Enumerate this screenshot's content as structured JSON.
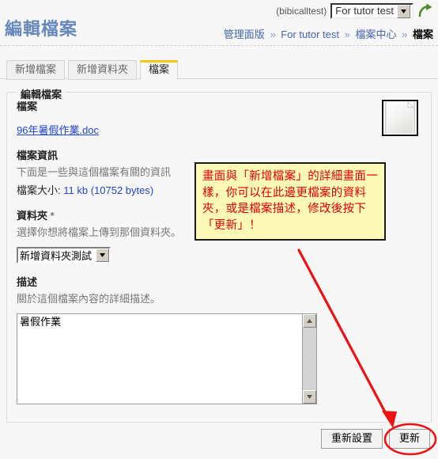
{
  "header": {
    "page_title": "編輯檔案",
    "username": "(bibicalltest)",
    "site_select_value": "For tutor test",
    "go_icon": "green-curved-arrow-icon",
    "breadcrumb": [
      {
        "label": "管理面版",
        "current": false
      },
      {
        "label": "For tutor test",
        "current": false
      },
      {
        "label": "檔案中心",
        "current": false
      },
      {
        "label": "檔案",
        "current": true
      }
    ],
    "breadcrumb_separator": "»"
  },
  "tabs": [
    {
      "label": "新增檔案",
      "active": false
    },
    {
      "label": "新增資料夾",
      "active": false
    },
    {
      "label": "檔案",
      "active": true
    }
  ],
  "form": {
    "legend": "編輯檔案",
    "file": {
      "label": "檔案",
      "link_text": "96年暑假作業.doc",
      "thumb_icon": "document-file-icon"
    },
    "file_info": {
      "label": "檔案資訊",
      "desc": "下面是一些與這個檔案有關的資訊",
      "size_label": "檔案大小:",
      "size_value": "11 kb (10752 bytes)"
    },
    "folder": {
      "label": "資料夾",
      "required_mark": "*",
      "desc": "選擇你想將檔案上傳到那個資料夾。",
      "select_value": "新增資料夾測試"
    },
    "description": {
      "label": "描述",
      "desc": "關於這個檔案內容的詳細描述。",
      "textarea_value": "暑假作業",
      "scroll_up_icon": "scroll-up-arrow-icon",
      "scroll_down_icon": "scroll-down-arrow-icon"
    }
  },
  "callout": {
    "text": "畫面與「新增檔案」的詳細畫面一樣，你可以在此邊更檔案的資料夾，或是檔案描述，修改後按下「更新」！",
    "background_color": "#fbf8b8",
    "text_color": "#dd0000",
    "border_color": "#1a1a1a"
  },
  "annotations": {
    "arrow_color": "#ee1111",
    "ellipse_color": "#ee1111",
    "arrow_name": "red-pointer-arrow",
    "ellipse_name": "red-highlight-ellipse"
  },
  "footer": {
    "reset_label": "重新設置",
    "submit_label": "更新"
  },
  "colors": {
    "page_background": "#f7f7f7",
    "title_color": "#6688bb",
    "active_tab_accent": "#f5c518",
    "link_color": "#2244cc"
  }
}
